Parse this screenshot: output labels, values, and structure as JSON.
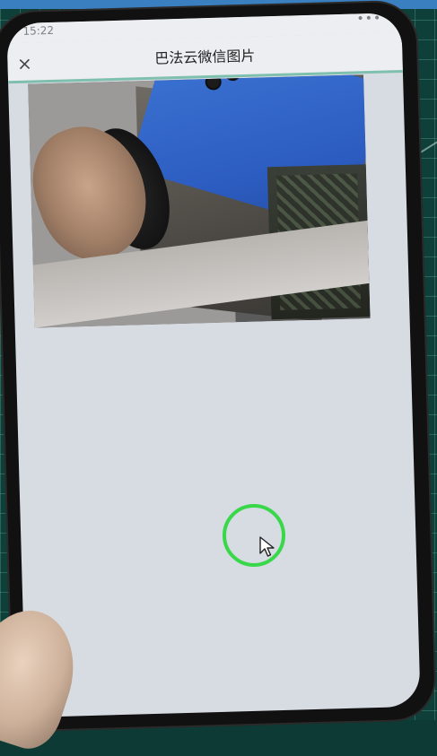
{
  "status_bar": {
    "time": "15:22",
    "menu_dots": "•••"
  },
  "header": {
    "title": "巴法云微信图片",
    "close_label": "×"
  },
  "photo": {
    "alt": ""
  },
  "colors": {
    "accent_line": "#7fbfae",
    "cursor_ring": "#38d84a",
    "screen_bg": "#d7dbe2"
  },
  "icons": {
    "close": "close-icon",
    "pointer": "mouse-pointer-icon"
  }
}
